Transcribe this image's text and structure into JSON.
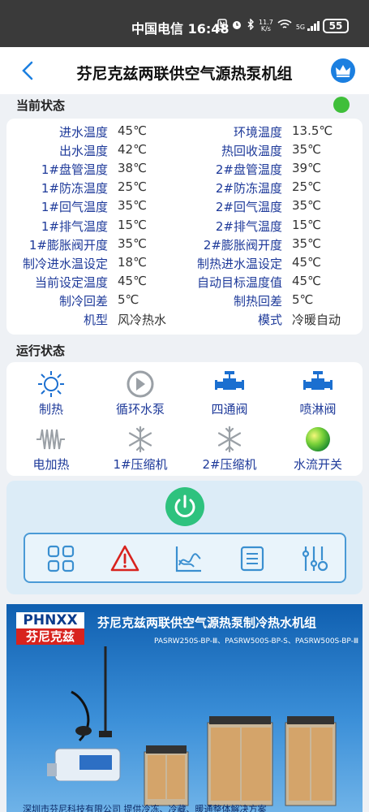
{
  "status_bar": {
    "carrier_time": "中国电信 16:48",
    "net_speed_value": "11.7",
    "net_speed_unit": "K/s",
    "signal_label": "5G",
    "battery": "55"
  },
  "header": {
    "title": "芬尼克兹两联供空气源热泵机组"
  },
  "current_status": {
    "section_label": "当前状态",
    "indicator_color": "#3fbf3a",
    "rows": [
      {
        "l1": "进水温度",
        "v1": "45℃",
        "l2": "环境温度",
        "v2": "13.5℃"
      },
      {
        "l1": "出水温度",
        "v1": "42℃",
        "l2": "热回收温度",
        "v2": "35℃"
      },
      {
        "l1": "1#盘管温度",
        "v1": "38℃",
        "l2": "2#盘管温度",
        "v2": "39℃"
      },
      {
        "l1": "1#防冻温度",
        "v1": "25℃",
        "l2": "2#防冻温度",
        "v2": "25℃"
      },
      {
        "l1": "1#回气温度",
        "v1": "35℃",
        "l2": "2#回气温度",
        "v2": "35℃"
      },
      {
        "l1": "1#排气温度",
        "v1": "15℃",
        "l2": "2#排气温度",
        "v2": "15℃"
      },
      {
        "l1": "1#膨胀阀开度",
        "v1": "35℃",
        "l2": "2#膨胀阀开度",
        "v2": "35℃"
      },
      {
        "l1": "制冷进水温设定",
        "v1": "18℃",
        "l2": "制热进水温设定",
        "v2": "45℃"
      },
      {
        "l1": "当前设定温度",
        "v1": "45℃",
        "l2": "自动目标温度值",
        "v2": "45℃"
      },
      {
        "l1": "制冷回差",
        "v1": "5℃",
        "l2": "制热回差",
        "v2": "5℃"
      },
      {
        "l1": "机型",
        "v1": "风冷热水",
        "l2": "模式",
        "v2": "冷暖自动"
      }
    ]
  },
  "run_status": {
    "section_label": "运行状态",
    "items": [
      {
        "label": "制热",
        "icon": "sun-icon"
      },
      {
        "label": "循环水泵",
        "icon": "pump-icon"
      },
      {
        "label": "四通阀",
        "icon": "valve-icon"
      },
      {
        "label": "喷淋阀",
        "icon": "spray-valve-icon"
      },
      {
        "label": "电加热",
        "icon": "electric-heater-icon"
      },
      {
        "label": "1#压缩机",
        "icon": "snowflake-icon"
      },
      {
        "label": "2#压缩机",
        "icon": "snowflake-icon"
      },
      {
        "label": "水流开关",
        "icon": "flow-switch-icon"
      }
    ]
  },
  "control": {
    "toolbar_icons": [
      "grid-icon",
      "alarm-icon",
      "chart-icon",
      "list-icon",
      "settings-sliders-icon"
    ]
  },
  "banner": {
    "brand_en": "PHNXX",
    "brand_cn": "芬尼克兹",
    "title": "芬尼克兹两联供空气源热泵制冷热水机组",
    "models": "PASRW250S-BP-Ⅲ、PASRW500S-BP-S、PASRW500S-BP-Ⅲ",
    "footer": "深圳市芬尼科技有限公司  提供冷冻、冷藏、暖通整体解决方案"
  },
  "colors": {
    "label_blue": "#1e3a9a",
    "icon_blue": "#1b6fd0",
    "icon_gray": "#9aa0a6",
    "power_green": "#2ec27e"
  }
}
